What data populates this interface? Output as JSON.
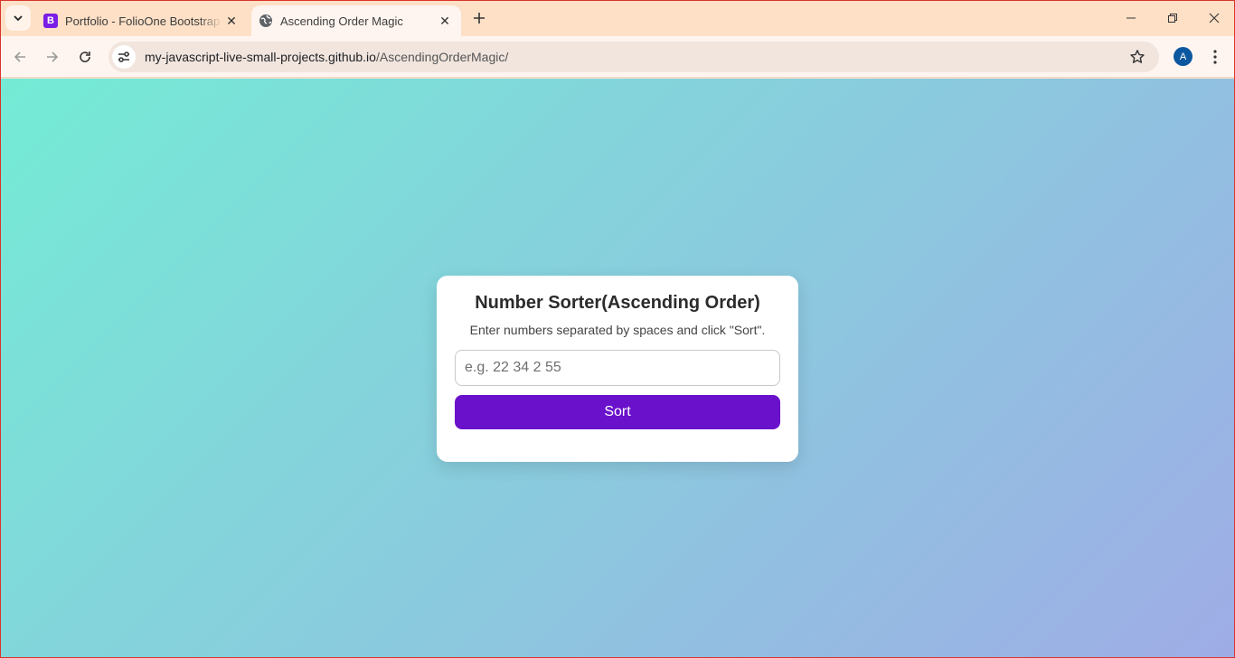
{
  "browser": {
    "tabs": [
      {
        "title": "Portfolio - FolioOne Bootstrap Template",
        "favicon_letter": "B",
        "active": false
      },
      {
        "title": "Ascending Order Magic",
        "active": true
      }
    ],
    "address": {
      "host": "my-javascript-live-small-projects.github.io",
      "path": "/AscendingOrderMagic/"
    },
    "profile_initial": "A"
  },
  "page": {
    "title": "Number Sorter(Ascending Order)",
    "instructions": "Enter numbers separated by spaces and click \"Sort\".",
    "input": {
      "placeholder": "e.g. 22 34 2 55",
      "value": ""
    },
    "sort_button": "Sort"
  },
  "colors": {
    "gradient_start": "#74ebd5",
    "gradient_end": "#9face6",
    "button": "#6a11cb",
    "tabstrip": "#fde0c6"
  }
}
